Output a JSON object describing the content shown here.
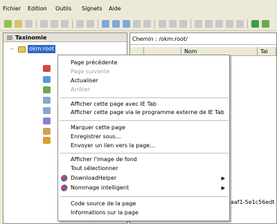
{
  "menubar": {
    "items": [
      "Fichier",
      "Edition",
      "Outils",
      "Signets",
      "Aide"
    ]
  },
  "tree": {
    "header": "Taxinomie",
    "root_label": "okm:root"
  },
  "right": {
    "path_text": "Chemin : /okm:root/",
    "columns": [
      "Nom",
      "Tai"
    ],
    "fragment_text": "aaf1-5e1c56edt"
  },
  "context_menu": {
    "items": [
      {
        "label": "Page précédente",
        "disabled": false
      },
      {
        "label": "Page suivante",
        "disabled": true
      },
      {
        "label": "Actualiser",
        "disabled": false
      },
      {
        "label": "Arrêter",
        "disabled": true
      },
      {
        "label": "Afficher cette page avec IE Tab",
        "disabled": false
      },
      {
        "label": "Afficher cette page via le programme externe de IE Tab",
        "disabled": false
      },
      {
        "label": "Marquer cette page",
        "disabled": false
      },
      {
        "label": "Enregistrer sous...",
        "disabled": false
      },
      {
        "label": "Envoyer un lien vers la page...",
        "disabled": false
      },
      {
        "label": "Afficher l'image de fond",
        "disabled": false
      },
      {
        "label": "Tout sélectionner",
        "disabled": false
      },
      {
        "label": "DownloadHelper",
        "disabled": false,
        "submenu": true
      },
      {
        "label": "Nommage intelligent",
        "disabled": false,
        "submenu": true
      },
      {
        "label": "Code source de la page",
        "disabled": false
      },
      {
        "label": "Informations sur la page",
        "disabled": false
      }
    ],
    "submenu_arrow": "▶"
  },
  "colors": {
    "menu_bg": "#ffffff",
    "window_bg": "#ece9d8",
    "selection": "#316ac5",
    "disabled_text": "#a0a0a0"
  }
}
